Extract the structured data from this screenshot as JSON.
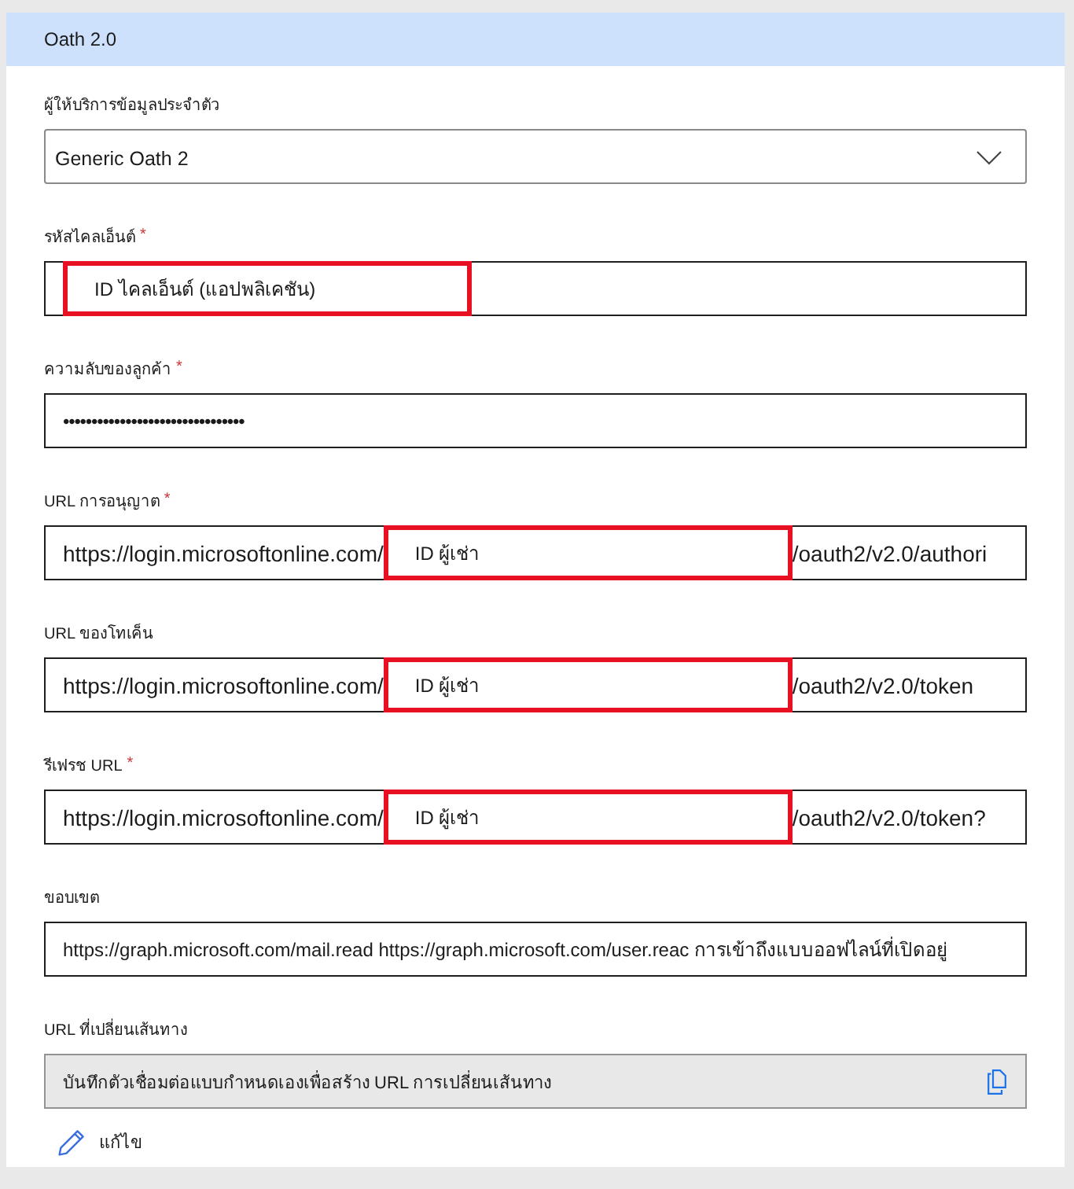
{
  "panel": {
    "title": "Oath 2.0"
  },
  "fields": [
    {
      "kind": "select",
      "label": "ผู้ให้บริการข้อมูลประจำตัว",
      "value": "Generic Oath 2"
    },
    {
      "kind": "text",
      "label": "รหัสไคลเอ็นต์",
      "required_mark": "*",
      "segments": [
        {
          "text": "ID ไคลเอ็นต์ (แอปพลิเคชัน)",
          "highlighted": true
        }
      ]
    },
    {
      "kind": "password",
      "label": "ความลับของลูกค้า",
      "required_mark": "*",
      "value": "••••••••••••••••••••••••••••••••"
    },
    {
      "kind": "text",
      "label": "URL การอนุญาต",
      "required_mark": "*",
      "segments": [
        {
          "text": "https://login.microsoftonline.com/",
          "highlighted": false
        },
        {
          "text": "ID ผู้เช่า",
          "highlighted": true
        },
        {
          "text": "/oauth2/v2.0/authori",
          "highlighted": false
        }
      ]
    },
    {
      "kind": "text",
      "label": "URL ของโทเค็น",
      "segments": [
        {
          "text": "https://login.microsoftonline.com/",
          "highlighted": false
        },
        {
          "text": "ID ผู้เช่า",
          "highlighted": true
        },
        {
          "text": "/oauth2/v2.0/token",
          "highlighted": false
        }
      ]
    },
    {
      "kind": "text",
      "label": "รีเฟรช URL",
      "required_mark": "*",
      "segments": [
        {
          "text": "https://login.microsoftonline.com/",
          "highlighted": false
        },
        {
          "text": "ID ผู้เช่า",
          "highlighted": true
        },
        {
          "text": "/oauth2/v2.0/token?",
          "highlighted": false
        }
      ]
    },
    {
      "kind": "text",
      "label": "ขอบเขต",
      "segments": [
        {
          "text": "https://graph.microsoft.com/mail.read https://graph.microsoft.com/user.reac การเข้าถึงแบบออฟไลน์ที่เปิดอยู่",
          "highlighted": false
        }
      ]
    },
    {
      "kind": "readonly",
      "label": "URL ที่เปลี่ยนเส้นทาง",
      "value": "บันทึกตัวเชื่อมต่อแบบกำหนดเองเพื่อสร้าง URL การเปลี่ยนเส้นทาง"
    }
  ],
  "edit_link": {
    "label": "แก้ไข"
  }
}
